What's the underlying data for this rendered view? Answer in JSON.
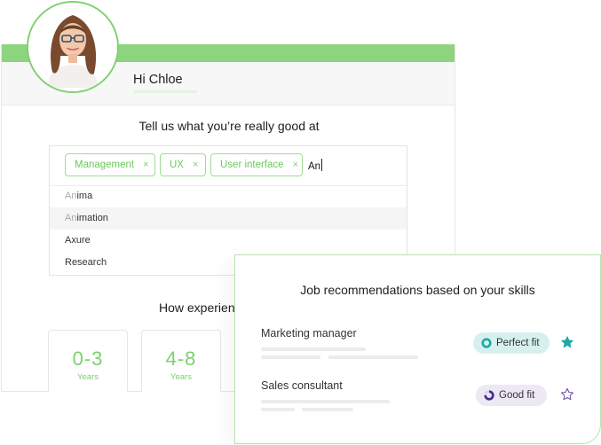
{
  "profile": {
    "greeting": "Hi Chloe",
    "avatar_alt": "profile photo",
    "accent_color": "#8cd47e"
  },
  "skills_section": {
    "title": "Tell us what you’re really good at",
    "chips": [
      {
        "label": "Management",
        "remove": "×"
      },
      {
        "label": "UX",
        "remove": "×"
      },
      {
        "label": "User interface",
        "remove": "×"
      }
    ],
    "input_value": "An",
    "suggestions": [
      {
        "match": "An",
        "rest": "ima",
        "highlighted": false
      },
      {
        "match": "An",
        "rest": "imation",
        "highlighted": true
      },
      {
        "match": "",
        "rest": "Axure",
        "highlighted": false
      },
      {
        "match": "",
        "rest": "Research",
        "highlighted": false
      }
    ]
  },
  "experience_section": {
    "title": "How experienc",
    "options": [
      {
        "range": "0-3",
        "unit": "Years"
      },
      {
        "range": "4-8",
        "unit": "Years"
      }
    ]
  },
  "recommendations": {
    "title": "Job recommendations based on your skills",
    "jobs": [
      {
        "title": "Marketing manager",
        "fit": "Perfect fit",
        "fit_color": "#1fa8a8",
        "starred": true
      },
      {
        "title": "Sales consultant",
        "fit": "Good fit",
        "fit_color": "#4b2a8c",
        "starred": false
      }
    ]
  }
}
